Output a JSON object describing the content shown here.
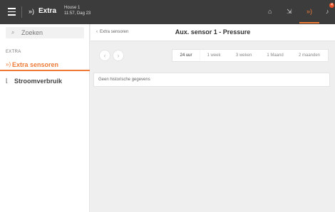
{
  "topbar": {
    "title": "Extra",
    "house_name": "House 1",
    "datetime": "11:57, Dag 23",
    "notification_count": "4",
    "icons": [
      "menu-icon",
      "signal-icon",
      "home-icon",
      "exit-icon",
      "signal-icon",
      "bell-icon"
    ]
  },
  "sidebar": {
    "search_placeholder": "Zoeken",
    "section_label": "EXTRA",
    "items": [
      {
        "label": "Extra sensoren",
        "icon": "signal-icon",
        "active": true
      },
      {
        "label": "Stroomverbruik",
        "icon": "chart-icon",
        "active": false
      }
    ]
  },
  "header": {
    "back_label": "Extra sensoren",
    "title": "Aux. sensor 1 - Pressure"
  },
  "range": {
    "tabs": [
      "24 uur",
      "1 week",
      "3 weken",
      "1 Maand",
      "2 maanden"
    ],
    "selected": "24 uur"
  },
  "notice": {
    "text": "Geen historische gegevens"
  },
  "colors": {
    "accent": "#ee7a36",
    "topbar": "#3c3c3c",
    "background": "#efefef"
  }
}
